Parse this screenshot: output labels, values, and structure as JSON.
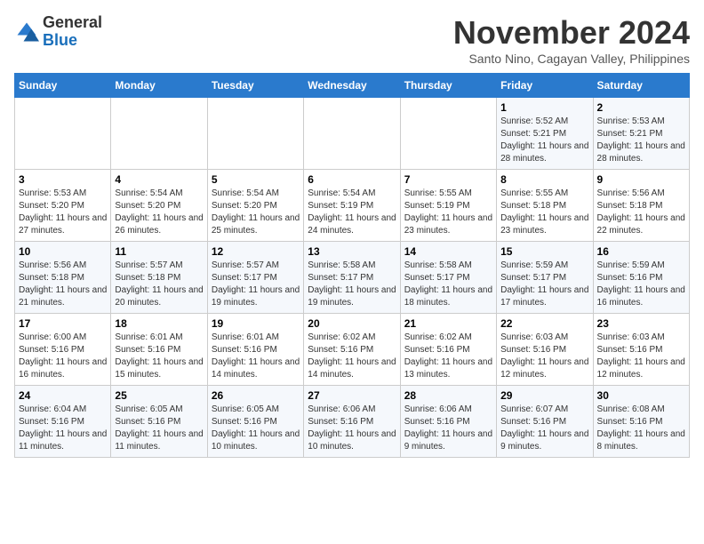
{
  "header": {
    "logo": {
      "general": "General",
      "blue": "Blue"
    },
    "title": "November 2024",
    "location": "Santo Nino, Cagayan Valley, Philippines"
  },
  "calendar": {
    "weekdays": [
      "Sunday",
      "Monday",
      "Tuesday",
      "Wednesday",
      "Thursday",
      "Friday",
      "Saturday"
    ],
    "weeks": [
      [
        {
          "day": "",
          "info": ""
        },
        {
          "day": "",
          "info": ""
        },
        {
          "day": "",
          "info": ""
        },
        {
          "day": "",
          "info": ""
        },
        {
          "day": "",
          "info": ""
        },
        {
          "day": "1",
          "info": "Sunrise: 5:52 AM\nSunset: 5:21 PM\nDaylight: 11 hours and 28 minutes."
        },
        {
          "day": "2",
          "info": "Sunrise: 5:53 AM\nSunset: 5:21 PM\nDaylight: 11 hours and 28 minutes."
        }
      ],
      [
        {
          "day": "3",
          "info": "Sunrise: 5:53 AM\nSunset: 5:20 PM\nDaylight: 11 hours and 27 minutes."
        },
        {
          "day": "4",
          "info": "Sunrise: 5:54 AM\nSunset: 5:20 PM\nDaylight: 11 hours and 26 minutes."
        },
        {
          "day": "5",
          "info": "Sunrise: 5:54 AM\nSunset: 5:20 PM\nDaylight: 11 hours and 25 minutes."
        },
        {
          "day": "6",
          "info": "Sunrise: 5:54 AM\nSunset: 5:19 PM\nDaylight: 11 hours and 24 minutes."
        },
        {
          "day": "7",
          "info": "Sunrise: 5:55 AM\nSunset: 5:19 PM\nDaylight: 11 hours and 23 minutes."
        },
        {
          "day": "8",
          "info": "Sunrise: 5:55 AM\nSunset: 5:18 PM\nDaylight: 11 hours and 23 minutes."
        },
        {
          "day": "9",
          "info": "Sunrise: 5:56 AM\nSunset: 5:18 PM\nDaylight: 11 hours and 22 minutes."
        }
      ],
      [
        {
          "day": "10",
          "info": "Sunrise: 5:56 AM\nSunset: 5:18 PM\nDaylight: 11 hours and 21 minutes."
        },
        {
          "day": "11",
          "info": "Sunrise: 5:57 AM\nSunset: 5:18 PM\nDaylight: 11 hours and 20 minutes."
        },
        {
          "day": "12",
          "info": "Sunrise: 5:57 AM\nSunset: 5:17 PM\nDaylight: 11 hours and 19 minutes."
        },
        {
          "day": "13",
          "info": "Sunrise: 5:58 AM\nSunset: 5:17 PM\nDaylight: 11 hours and 19 minutes."
        },
        {
          "day": "14",
          "info": "Sunrise: 5:58 AM\nSunset: 5:17 PM\nDaylight: 11 hours and 18 minutes."
        },
        {
          "day": "15",
          "info": "Sunrise: 5:59 AM\nSunset: 5:17 PM\nDaylight: 11 hours and 17 minutes."
        },
        {
          "day": "16",
          "info": "Sunrise: 5:59 AM\nSunset: 5:16 PM\nDaylight: 11 hours and 16 minutes."
        }
      ],
      [
        {
          "day": "17",
          "info": "Sunrise: 6:00 AM\nSunset: 5:16 PM\nDaylight: 11 hours and 16 minutes."
        },
        {
          "day": "18",
          "info": "Sunrise: 6:01 AM\nSunset: 5:16 PM\nDaylight: 11 hours and 15 minutes."
        },
        {
          "day": "19",
          "info": "Sunrise: 6:01 AM\nSunset: 5:16 PM\nDaylight: 11 hours and 14 minutes."
        },
        {
          "day": "20",
          "info": "Sunrise: 6:02 AM\nSunset: 5:16 PM\nDaylight: 11 hours and 14 minutes."
        },
        {
          "day": "21",
          "info": "Sunrise: 6:02 AM\nSunset: 5:16 PM\nDaylight: 11 hours and 13 minutes."
        },
        {
          "day": "22",
          "info": "Sunrise: 6:03 AM\nSunset: 5:16 PM\nDaylight: 11 hours and 12 minutes."
        },
        {
          "day": "23",
          "info": "Sunrise: 6:03 AM\nSunset: 5:16 PM\nDaylight: 11 hours and 12 minutes."
        }
      ],
      [
        {
          "day": "24",
          "info": "Sunrise: 6:04 AM\nSunset: 5:16 PM\nDaylight: 11 hours and 11 minutes."
        },
        {
          "day": "25",
          "info": "Sunrise: 6:05 AM\nSunset: 5:16 PM\nDaylight: 11 hours and 11 minutes."
        },
        {
          "day": "26",
          "info": "Sunrise: 6:05 AM\nSunset: 5:16 PM\nDaylight: 11 hours and 10 minutes."
        },
        {
          "day": "27",
          "info": "Sunrise: 6:06 AM\nSunset: 5:16 PM\nDaylight: 11 hours and 10 minutes."
        },
        {
          "day": "28",
          "info": "Sunrise: 6:06 AM\nSunset: 5:16 PM\nDaylight: 11 hours and 9 minutes."
        },
        {
          "day": "29",
          "info": "Sunrise: 6:07 AM\nSunset: 5:16 PM\nDaylight: 11 hours and 9 minutes."
        },
        {
          "day": "30",
          "info": "Sunrise: 6:08 AM\nSunset: 5:16 PM\nDaylight: 11 hours and 8 minutes."
        }
      ]
    ]
  }
}
